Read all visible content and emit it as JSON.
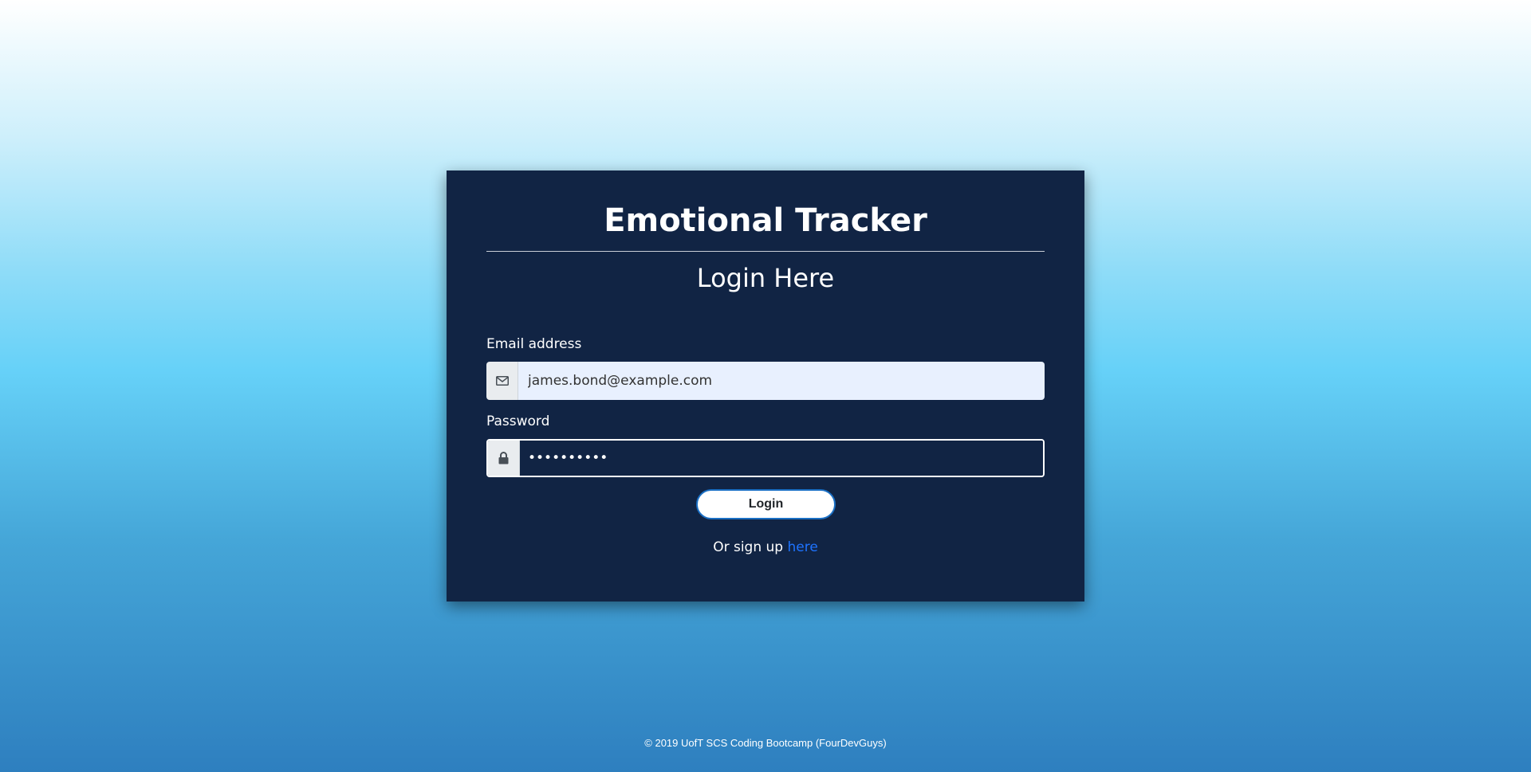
{
  "app": {
    "title": "Emotional Tracker",
    "subtitle": "Login Here"
  },
  "form": {
    "email_label": "Email address",
    "email_value": "james.bond@example.com",
    "email_icon": "envelope-icon",
    "password_label": "Password",
    "password_value": "••••••••••",
    "password_icon": "lock-icon",
    "login_button": "Login",
    "signup_prefix": "Or sign up ",
    "signup_link": "here"
  },
  "footer": {
    "text": "© 2019 UofT SCS Coding Bootcamp (FourDevGuys)"
  },
  "colors": {
    "card_bg": "#112444",
    "link": "#1e73ff",
    "email_field_bg": "#e8f0fe"
  }
}
